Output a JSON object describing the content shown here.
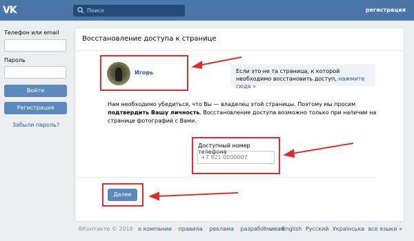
{
  "header": {
    "logo": "VK",
    "search_placeholder": "Поиск",
    "register_link": "регистрация"
  },
  "sidebar": {
    "phone_label": "Телефон или email",
    "password_label": "Пароль",
    "login_button": "Войти",
    "register_button": "Регистрация",
    "forgot_link": "Забыли пароль?"
  },
  "card": {
    "title": "Восстановление доступа к странице",
    "profile_name": "Игорь",
    "not_me_text": "Если это не та страница, к которой необходимо восстановить доступ,",
    "not_me_link": "нажмите сюда »",
    "info_before": "Нам необходимо убедиться, что Вы — владелец этой страницы. Поэтому мы просим",
    "info_bold": "подтвердить Вашу личность",
    "info_after": ". Восстановление доступа возможно только при наличии на странице фотографий с Вами.",
    "phone_label": "Доступный номер телефона",
    "phone_value": "+7 921 0000007",
    "next_button": "Далее"
  },
  "footer": {
    "copyright": "ВКонтакте © 2018",
    "links": [
      "о компании",
      "правила",
      "реклама",
      "разработчикам"
    ],
    "language_label": "Язык:",
    "languages": [
      "English",
      "Русский",
      "Українська",
      "все языки »"
    ]
  },
  "colors": {
    "brand": "#4a76a8",
    "button": "#5b88bd",
    "link": "#2a5885",
    "highlight": "#e02b2b"
  },
  "icons": [
    "vk-logo",
    "search-icon",
    "red-arrow"
  ]
}
